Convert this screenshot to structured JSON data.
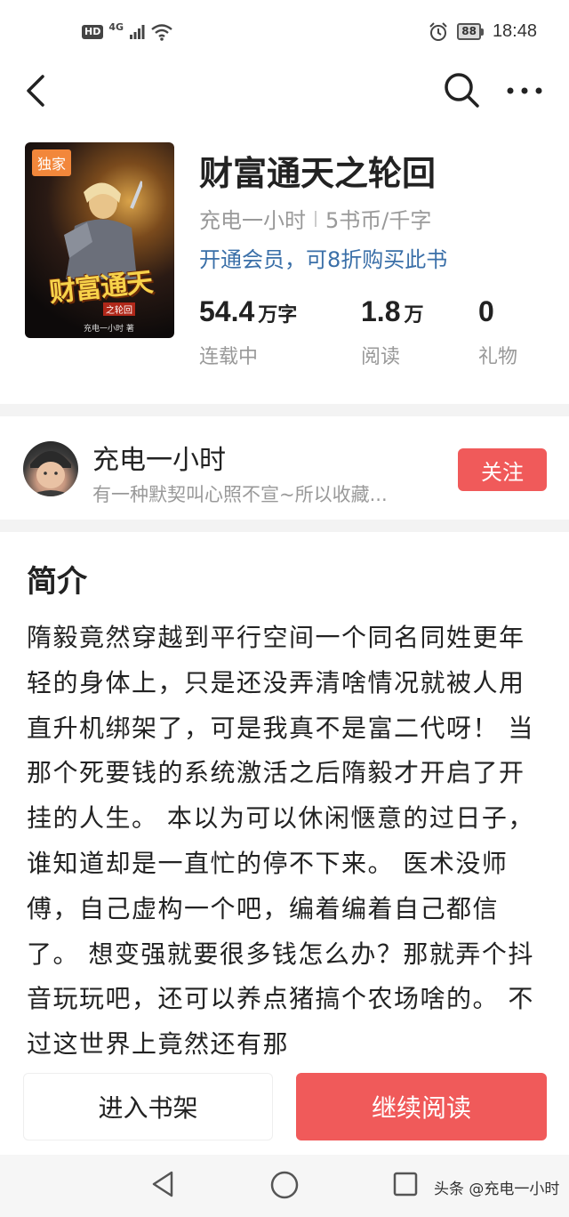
{
  "status_bar": {
    "hd": "HD",
    "network": "4G",
    "battery": "88",
    "time": "18:48"
  },
  "nav": {
    "icons": [
      "back-arrow-icon",
      "search-icon",
      "more-icon"
    ]
  },
  "book": {
    "cover_badge": "独家",
    "cover_title": "财富通天",
    "cover_subtitle": "之轮回",
    "cover_author": "充电一小时 著",
    "title": "财富通天之轮回",
    "author": "充电一小时",
    "price": "5书币/千字",
    "vip_offer": "开通会员，可8折购买此书",
    "stats": [
      {
        "value": "54.4",
        "unit": "万字",
        "label": "连载中"
      },
      {
        "value": "1.8",
        "unit": "万",
        "label": "阅读"
      },
      {
        "value": "0",
        "unit": "",
        "label": "礼物"
      }
    ]
  },
  "author_row": {
    "name": "充电一小时",
    "signature": "有一种默契叫心照不宣~所以收藏...",
    "follow_label": "关注"
  },
  "intro": {
    "heading": "简介",
    "text": "隋毅竟然穿越到平行空间一个同名同姓更年轻的身体上，只是还没弄清啥情况就被人用直升机绑架了，可是我真不是富二代呀！ 当那个死要钱的系统激活之后隋毅才开启了开挂的人生。 本以为可以休闲惬意的过日子，谁知道却是一直忙的停不下来。 医术没师傅，自己虚构一个吧，编着编着自己都信了。 想变强就要很多钱怎么办？那就弄个抖音玩玩吧，还可以养点猪搞个农场啥的。 不过这世界上竟然还有那"
  },
  "actions": {
    "add_to_shelf": "进入书架",
    "continue_reading": "继续阅读"
  },
  "system_nav": {
    "icons": [
      "triangle-back-icon",
      "circle-home-icon",
      "square-recent-icon"
    ],
    "watermark": "头条 @充电一小时"
  },
  "colors": {
    "accent_red": "#f05a5a",
    "link_blue": "#3a6fa8",
    "muted_gray": "#999999",
    "badge_orange": "#f2873b"
  }
}
